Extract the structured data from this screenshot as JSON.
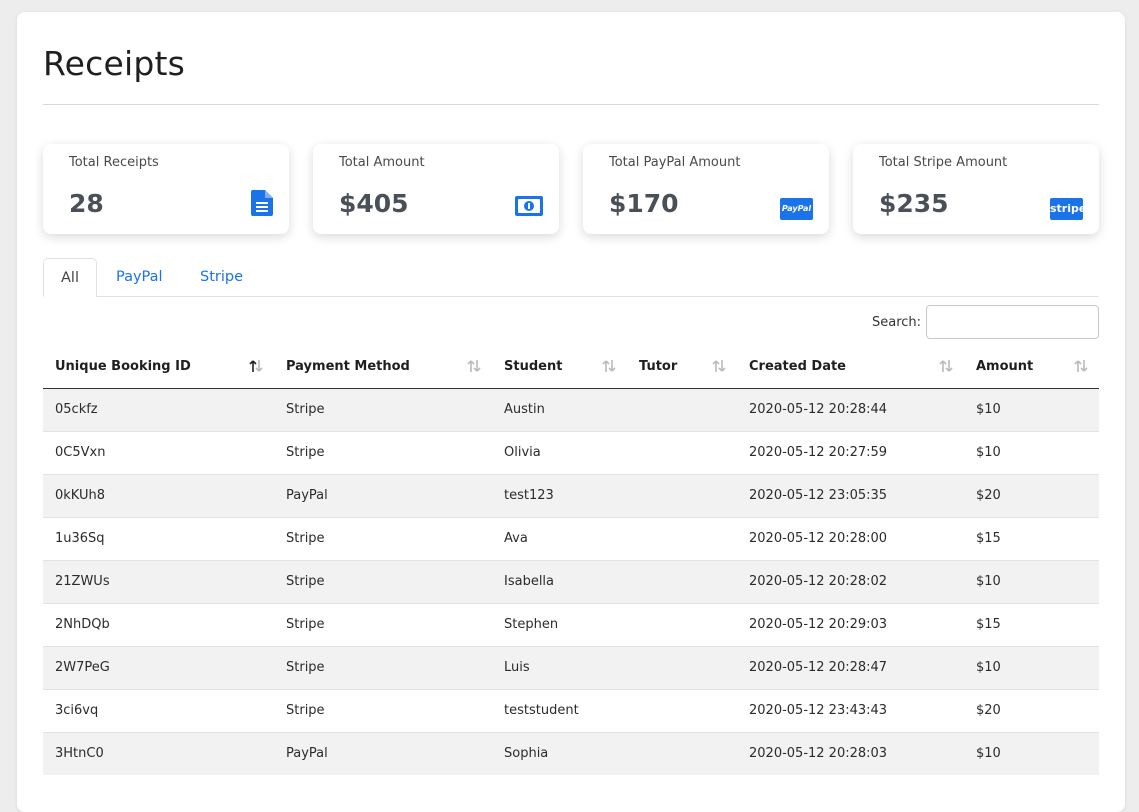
{
  "page": {
    "title": "Receipts"
  },
  "cards": [
    {
      "label": "Total Receipts",
      "value": "28",
      "icon": "document-icon"
    },
    {
      "label": "Total Amount",
      "value": "$405",
      "icon": "money-icon"
    },
    {
      "label": "Total PayPal Amount",
      "value": "$170",
      "icon": "paypal-icon",
      "icon_text": "PayPal"
    },
    {
      "label": "Total Stripe Amount",
      "value": "$235",
      "icon": "stripe-icon",
      "icon_text": "stripe"
    }
  ],
  "tabs": [
    {
      "label": "All",
      "active": true
    },
    {
      "label": "PayPal",
      "active": false
    },
    {
      "label": "Stripe",
      "active": false
    }
  ],
  "search": {
    "label": "Search:",
    "value": ""
  },
  "table": {
    "columns": [
      "Unique Booking ID",
      "Payment Method",
      "Student",
      "Tutor",
      "Created Date",
      "Amount"
    ],
    "sorted_column": "Unique Booking ID",
    "sort_direction": "ascending",
    "rows": [
      [
        "05ckfz",
        "Stripe",
        "Austin",
        "",
        "2020-05-12 20:28:44",
        "$10"
      ],
      [
        "0C5Vxn",
        "Stripe",
        "Olivia",
        "",
        "2020-05-12 20:27:59",
        "$10"
      ],
      [
        "0kKUh8",
        "PayPal",
        "test123",
        "",
        "2020-05-12 23:05:35",
        "$20"
      ],
      [
        "1u36Sq",
        "Stripe",
        "Ava",
        "",
        "2020-05-12 20:28:00",
        "$15"
      ],
      [
        "21ZWUs",
        "Stripe",
        "Isabella",
        "",
        "2020-05-12 20:28:02",
        "$10"
      ],
      [
        "2NhDQb",
        "Stripe",
        "Stephen",
        "",
        "2020-05-12 20:29:03",
        "$15"
      ],
      [
        "2W7PeG",
        "Stripe",
        "Luis",
        "",
        "2020-05-12 20:28:47",
        "$10"
      ],
      [
        "3ci6vq",
        "Stripe",
        "teststudent",
        "",
        "2020-05-12 23:43:43",
        "$20"
      ],
      [
        "3HtnC0",
        "PayPal",
        "Sophia",
        "",
        "2020-05-12 20:28:03",
        "$10"
      ]
    ]
  },
  "colors": {
    "accent": "#1a73e8",
    "icon_blue": "#1a73e8",
    "row_stripe": "#f2f2f2"
  }
}
